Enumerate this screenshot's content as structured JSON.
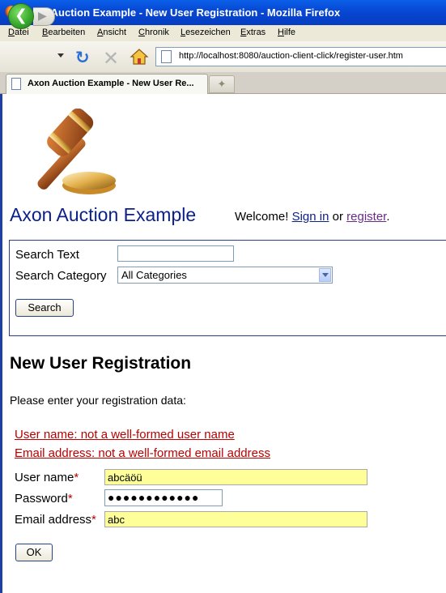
{
  "window": {
    "title": "Axon Auction Example - New User Registration - Mozilla Firefox"
  },
  "menu": [
    "Datei",
    "Bearbeiten",
    "Ansicht",
    "Chronik",
    "Lesezeichen",
    "Extras",
    "Hilfe"
  ],
  "address_bar": {
    "url": "http://localhost:8080/auction-client-click/register-user.htm"
  },
  "tabs": [
    {
      "label": "Axon Auction Example - New User Re..."
    }
  ],
  "header": {
    "site_title": "Axon Auction Example",
    "welcome_text": "Welcome!",
    "sign_in_link": "Sign in",
    "or_text": "or",
    "register_link": "register",
    "period": "."
  },
  "search": {
    "text_label": "Search Text",
    "text_value": "",
    "category_label": "Search Category",
    "category_value": "All Categories",
    "button_label": "Search"
  },
  "registration": {
    "heading": "New User Registration",
    "intro": "Please enter your registration data:",
    "errors": [
      "User name: not a well-formed user name",
      "Email address: not a well-formed email address"
    ],
    "username_label": "User name",
    "username_value": "abcäöü",
    "password_label": "Password",
    "password_value": "●●●●●●●●●●●●",
    "email_label": "Email address",
    "email_value": "abc",
    "required_marker": "*",
    "ok_label": "OK"
  },
  "colors": {
    "titlebar": "#0747d3",
    "site_title": "#0a1f88",
    "error": "#bb0000",
    "invalid_field": "#ffff99"
  },
  "icons": [
    "firefox-icon",
    "back-arrow-icon",
    "forward-arrow-icon",
    "reload-icon",
    "stop-icon",
    "home-icon",
    "page-icon",
    "gavel-logo-icon"
  ]
}
